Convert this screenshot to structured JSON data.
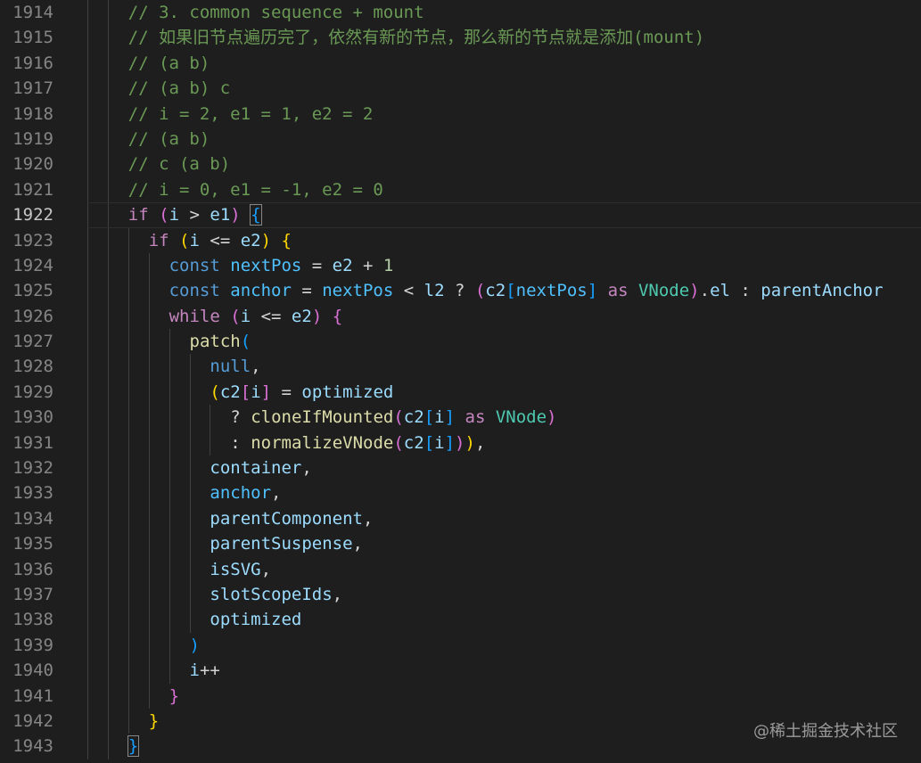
{
  "editor": {
    "current_line": "1922",
    "watermark": "@稀土掘金技术社区",
    "colors": {
      "background": "#1e1e1e",
      "line_number": "#858585",
      "comment": "#6a9955",
      "keyword_control": "#c586c0",
      "keyword": "#569cd6",
      "variable": "#9cdcfe",
      "constant": "#4fc1ff",
      "function": "#dcdcaa",
      "type": "#4ec9b0",
      "number": "#b5cea8",
      "bracket_1": "#ffd700",
      "bracket_2": "#da70d6",
      "bracket_3": "#179fff"
    },
    "lines": [
      {
        "n": "1914",
        "indent": 2,
        "tokens": [
          [
            "c",
            "// 3. common sequence + mount"
          ]
        ]
      },
      {
        "n": "1915",
        "indent": 2,
        "tokens": [
          [
            "c",
            "// 如果旧节点遍历完了，依然有新的节点，那么新的节点就是添加(mount)"
          ]
        ]
      },
      {
        "n": "1916",
        "indent": 2,
        "tokens": [
          [
            "c",
            "// (a b)"
          ]
        ]
      },
      {
        "n": "1917",
        "indent": 2,
        "tokens": [
          [
            "c",
            "// (a b) c"
          ]
        ]
      },
      {
        "n": "1918",
        "indent": 2,
        "tokens": [
          [
            "c",
            "// i = 2, e1 = 1, e2 = 2"
          ]
        ]
      },
      {
        "n": "1919",
        "indent": 2,
        "tokens": [
          [
            "c",
            "// (a b)"
          ]
        ]
      },
      {
        "n": "1920",
        "indent": 2,
        "tokens": [
          [
            "c",
            "// c (a b)"
          ]
        ]
      },
      {
        "n": "1921",
        "indent": 2,
        "tokens": [
          [
            "c",
            "// i = 0, e1 = -1, e2 = 0"
          ]
        ]
      },
      {
        "n": "1922",
        "indent": 2,
        "current": true,
        "tokens": [
          [
            "kc",
            "if"
          ],
          [
            "p",
            " "
          ],
          [
            "b2",
            "("
          ],
          [
            "v",
            "i"
          ],
          [
            "p",
            " > "
          ],
          [
            "v",
            "e1"
          ],
          [
            "b2",
            ")"
          ],
          [
            "p",
            " "
          ],
          [
            "b3m",
            "{"
          ]
        ]
      },
      {
        "n": "1923",
        "indent": 3,
        "tokens": [
          [
            "kc",
            "if"
          ],
          [
            "p",
            " "
          ],
          [
            "b1",
            "("
          ],
          [
            "v",
            "i"
          ],
          [
            "p",
            " <= "
          ],
          [
            "v",
            "e2"
          ],
          [
            "b1",
            ")"
          ],
          [
            "p",
            " "
          ],
          [
            "b1",
            "{"
          ]
        ]
      },
      {
        "n": "1924",
        "indent": 4,
        "tokens": [
          [
            "k",
            "const"
          ],
          [
            "p",
            " "
          ],
          [
            "k2",
            "nextPos"
          ],
          [
            "p",
            " = "
          ],
          [
            "v",
            "e2"
          ],
          [
            "p",
            " + "
          ],
          [
            "num",
            "1"
          ]
        ]
      },
      {
        "n": "1925",
        "indent": 4,
        "tokens": [
          [
            "k",
            "const"
          ],
          [
            "p",
            " "
          ],
          [
            "k2",
            "anchor"
          ],
          [
            "p",
            " = "
          ],
          [
            "k2",
            "nextPos"
          ],
          [
            "p",
            " < "
          ],
          [
            "v",
            "l2"
          ],
          [
            "p",
            " ? "
          ],
          [
            "b2",
            "("
          ],
          [
            "v",
            "c2"
          ],
          [
            "b3",
            "["
          ],
          [
            "k2",
            "nextPos"
          ],
          [
            "b3",
            "]"
          ],
          [
            "p",
            " "
          ],
          [
            "kc",
            "as"
          ],
          [
            "p",
            " "
          ],
          [
            "ty",
            "VNode"
          ],
          [
            "b2",
            ")"
          ],
          [
            "p",
            "."
          ],
          [
            "v",
            "el"
          ],
          [
            "p",
            " : "
          ],
          [
            "v",
            "parentAnchor"
          ]
        ]
      },
      {
        "n": "1926",
        "indent": 4,
        "tokens": [
          [
            "kc",
            "while"
          ],
          [
            "p",
            " "
          ],
          [
            "b2",
            "("
          ],
          [
            "v",
            "i"
          ],
          [
            "p",
            " <= "
          ],
          [
            "v",
            "e2"
          ],
          [
            "b2",
            ")"
          ],
          [
            "p",
            " "
          ],
          [
            "b2",
            "{"
          ]
        ]
      },
      {
        "n": "1927",
        "indent": 5,
        "tokens": [
          [
            "fn",
            "patch"
          ],
          [
            "b3",
            "("
          ]
        ]
      },
      {
        "n": "1928",
        "indent": 6,
        "tokens": [
          [
            "k",
            "null"
          ],
          [
            "p",
            ","
          ]
        ]
      },
      {
        "n": "1929",
        "indent": 6,
        "tokens": [
          [
            "b1",
            "("
          ],
          [
            "v",
            "c2"
          ],
          [
            "b2",
            "["
          ],
          [
            "v",
            "i"
          ],
          [
            "b2",
            "]"
          ],
          [
            "p",
            " = "
          ],
          [
            "v",
            "optimized"
          ]
        ]
      },
      {
        "n": "1930",
        "indent": 7,
        "tokens": [
          [
            "p",
            "? "
          ],
          [
            "fn",
            "cloneIfMounted"
          ],
          [
            "b2",
            "("
          ],
          [
            "v",
            "c2"
          ],
          [
            "b3",
            "["
          ],
          [
            "v",
            "i"
          ],
          [
            "b3",
            "]"
          ],
          [
            "p",
            " "
          ],
          [
            "kc",
            "as"
          ],
          [
            "p",
            " "
          ],
          [
            "ty",
            "VNode"
          ],
          [
            "b2",
            ")"
          ]
        ]
      },
      {
        "n": "1931",
        "indent": 7,
        "tokens": [
          [
            "p",
            ": "
          ],
          [
            "fn",
            "normalizeVNode"
          ],
          [
            "b2",
            "("
          ],
          [
            "v",
            "c2"
          ],
          [
            "b3",
            "["
          ],
          [
            "v",
            "i"
          ],
          [
            "b3",
            "]"
          ],
          [
            "b2",
            ")"
          ],
          [
            "b1",
            ")"
          ],
          [
            "p",
            ","
          ]
        ]
      },
      {
        "n": "1932",
        "indent": 6,
        "tokens": [
          [
            "v",
            "container"
          ],
          [
            "p",
            ","
          ]
        ]
      },
      {
        "n": "1933",
        "indent": 6,
        "tokens": [
          [
            "k2",
            "anchor"
          ],
          [
            "p",
            ","
          ]
        ]
      },
      {
        "n": "1934",
        "indent": 6,
        "tokens": [
          [
            "v",
            "parentComponent"
          ],
          [
            "p",
            ","
          ]
        ]
      },
      {
        "n": "1935",
        "indent": 6,
        "tokens": [
          [
            "v",
            "parentSuspense"
          ],
          [
            "p",
            ","
          ]
        ]
      },
      {
        "n": "1936",
        "indent": 6,
        "tokens": [
          [
            "v",
            "isSVG"
          ],
          [
            "p",
            ","
          ]
        ]
      },
      {
        "n": "1937",
        "indent": 6,
        "tokens": [
          [
            "v",
            "slotScopeIds"
          ],
          [
            "p",
            ","
          ]
        ]
      },
      {
        "n": "1938",
        "indent": 6,
        "tokens": [
          [
            "v",
            "optimized"
          ]
        ]
      },
      {
        "n": "1939",
        "indent": 5,
        "tokens": [
          [
            "b3",
            ")"
          ]
        ]
      },
      {
        "n": "1940",
        "indent": 5,
        "tokens": [
          [
            "v",
            "i"
          ],
          [
            "p",
            "++"
          ]
        ]
      },
      {
        "n": "1941",
        "indent": 4,
        "tokens": [
          [
            "b2",
            "}"
          ]
        ]
      },
      {
        "n": "1942",
        "indent": 3,
        "tokens": [
          [
            "b1",
            "}"
          ]
        ]
      },
      {
        "n": "1943",
        "indent": 2,
        "tokens": [
          [
            "b3m",
            "}"
          ]
        ]
      }
    ]
  }
}
